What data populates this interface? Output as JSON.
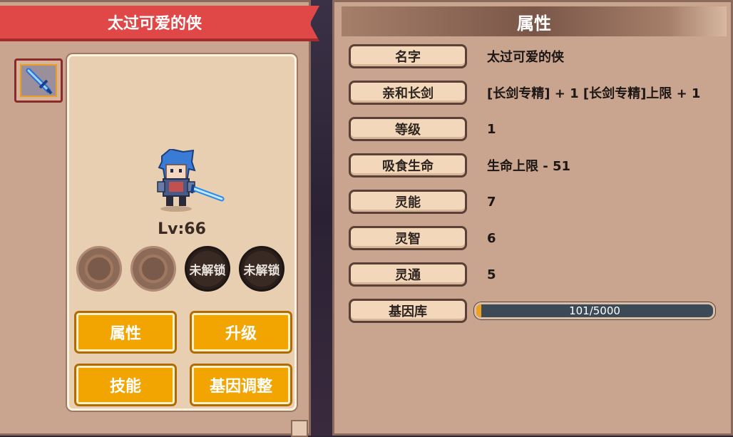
{
  "character": {
    "name": "太过可爱的侠",
    "level_text": "Lv:66"
  },
  "slots": [
    {
      "state": "open",
      "label": ""
    },
    {
      "state": "open",
      "label": ""
    },
    {
      "state": "locked",
      "label": "未解锁"
    },
    {
      "state": "locked",
      "label": "未解锁"
    }
  ],
  "buttons": {
    "attributes": "属性",
    "upgrade": "升级",
    "skills": "技能",
    "gene_adjust": "基因调整"
  },
  "attributes_panel": {
    "title": "属性",
    "rows": [
      {
        "label": "名字",
        "value": "太过可爱的侠"
      },
      {
        "label": "亲和长剑",
        "value": "[长剑专精] + 1 [长剑专精]上限 + 1"
      },
      {
        "label": "等级",
        "value": "1"
      },
      {
        "label": "吸食生命",
        "value": "生命上限 - 51"
      },
      {
        "label": "灵能",
        "value": "7"
      },
      {
        "label": "灵智",
        "value": "6"
      },
      {
        "label": "灵通",
        "value": "5"
      }
    ],
    "gene_bank": {
      "label": "基因库",
      "text": "101/5000",
      "progress": 0.0202
    }
  },
  "colors": {
    "banner": "#e04848",
    "button": "#f2a500",
    "panel": "#c9a48e",
    "gene_fill": "#f0a020"
  }
}
